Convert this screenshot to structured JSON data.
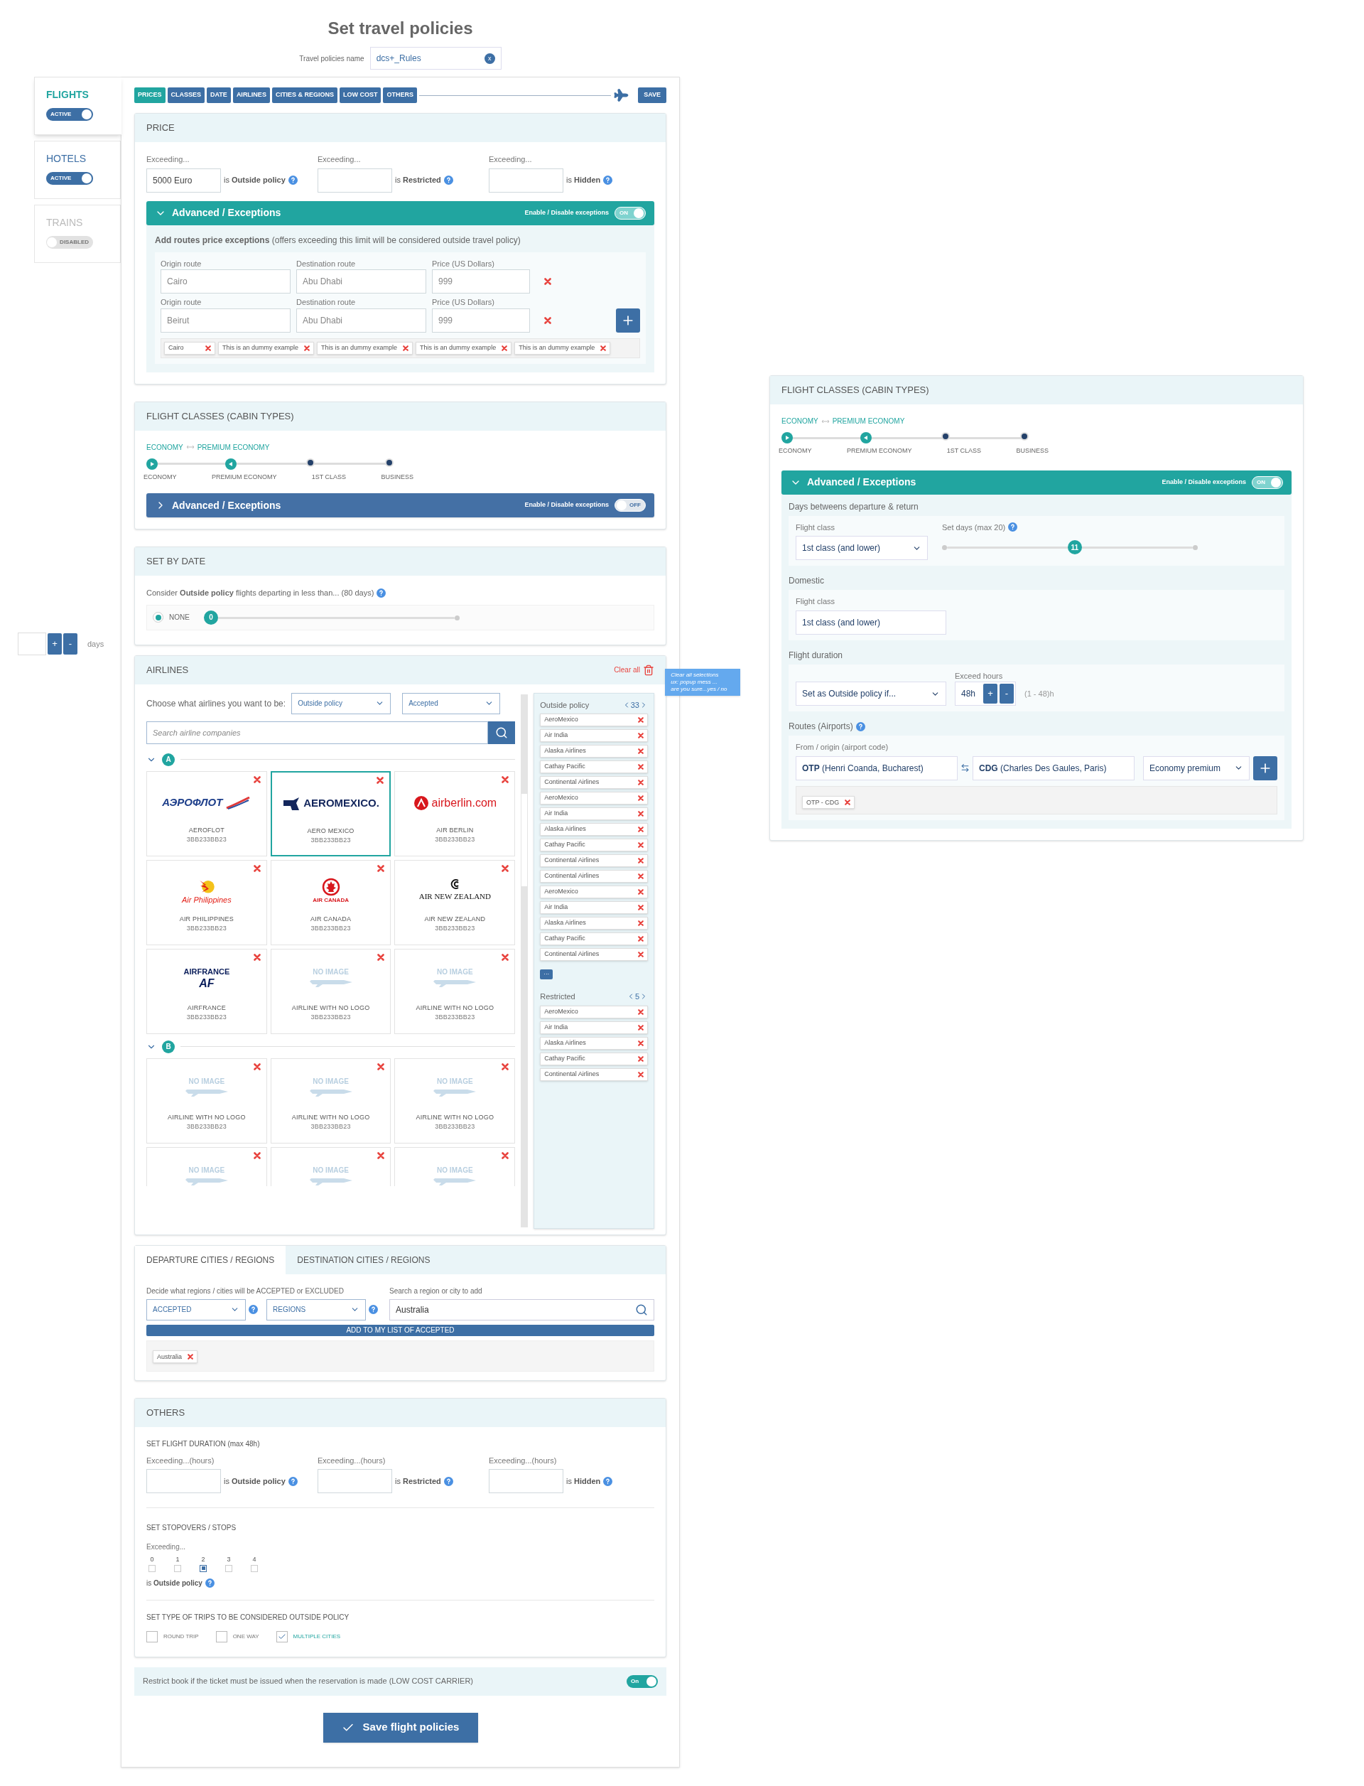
{
  "page_title": "Set travel policies",
  "policy_name": {
    "label": "Travel policies name",
    "value": "dcs+_Rules",
    "clear": "x"
  },
  "categories": [
    {
      "label": "FLIGHTS",
      "status": "ACTIVE",
      "on": true,
      "selected": true
    },
    {
      "label": "HOTELS",
      "status": "ACTIVE",
      "on": true,
      "selected": false
    },
    {
      "label": "TRAINS",
      "status": "DISABLED",
      "on": false,
      "selected": false
    }
  ],
  "days_widget": {
    "plus": "+",
    "minus": "-",
    "unit": "days"
  },
  "nav_tabs": [
    {
      "label": "PRICES",
      "selected": true
    },
    {
      "label": "CLASSES",
      "selected": false
    },
    {
      "label": "DATE",
      "selected": false
    },
    {
      "label": "AIRLINES",
      "selected": false
    },
    {
      "label": "CITIES & REGIONS",
      "selected": false
    },
    {
      "label": "LOW COST",
      "selected": false
    },
    {
      "label": "OTHERS",
      "selected": false
    }
  ],
  "save_top": "SAVE",
  "price": {
    "title": "PRICE",
    "thresholds": [
      {
        "label": "Exceeding...",
        "value": "5000 Euro",
        "suffix": "is **Outside policy**"
      },
      {
        "label": "Exceeding...",
        "suffix": "is **Restricted**"
      },
      {
        "label": "Exceeding...",
        "suffix": "is **Hidden**"
      }
    ],
    "advanced": {
      "title": "Advanced / Exceptions",
      "expanded": true,
      "toggle_label": "Enable / Disable exceptions",
      "on": true,
      "toggle_text": "ON"
    },
    "intro": "**Add routes price exceptions** (offers exceeding this limit will be considered outside travel policy)",
    "routes": [
      {
        "origin": {
          "label": "Origin route",
          "placeholder": "Cairo"
        },
        "dest": {
          "label": "Destination route",
          "placeholder": "Abu Dhabi"
        },
        "price": {
          "label": "Price (US Dollars)",
          "placeholder": "999"
        }
      },
      {
        "origin": {
          "label": "Origin route",
          "placeholder": "Beirut"
        },
        "dest": {
          "label": "Destination route",
          "placeholder": "Abu Dhabi"
        },
        "price": {
          "label": "Price (US Dollars)",
          "placeholder": "999"
        }
      }
    ],
    "tags": [
      "Cairo",
      "This is an dummy example",
      "This is an dummy example",
      "This is an dummy example",
      "This is an dummy example"
    ]
  },
  "classes": {
    "title": "FLIGHT CLASSES (CABIN TYPES)",
    "range_from": "ECONOMY",
    "range_to": "PREMIUM ECONOMY",
    "stops": [
      {
        "label": "ECONOMY",
        "kind": "start"
      },
      {
        "label": "PREMIUM ECONOMY",
        "kind": "end"
      },
      {
        "label": "1ST CLASS",
        "kind": "stop"
      },
      {
        "label": "BUSINESS",
        "kind": "stop"
      }
    ],
    "advanced": {
      "title": "Advanced / Exceptions",
      "expanded": false,
      "toggle_label": "Enable / Disable exceptions",
      "on": false,
      "toggle_text": "OFF"
    }
  },
  "by_date": {
    "title": "SET BY DATE",
    "text": "Consider **Outside policy** flights departing in less than... (80 days)",
    "radio": {
      "label": "NONE",
      "checked": true
    },
    "slider": {
      "value": "0",
      "level": 0
    }
  },
  "airlines": {
    "title": "AIRLINES",
    "clear_all": "Clear all",
    "tooltip": [
      "Clear all selections",
      "ux: popup mess ...",
      "are you sure...yes / no"
    ],
    "choose_label": "Choose what airlines you want to be:",
    "selects": [
      "Outside policy",
      "Accepted"
    ],
    "search_placeholder": "Search airline companies",
    "groups": [
      {
        "letter": "A",
        "expanded": true,
        "items": [
          {
            "name": "AEROFLOT",
            "code": "3BB233BB23",
            "kind": "aeroflot",
            "logo_lines": [
              "АЭРОФЛОТ"
            ],
            "selected": false
          },
          {
            "name": "AERO MEXICO",
            "code": "3BB233BB23",
            "kind": "aeromexico",
            "logo_lines": [
              "AEROMEXICO."
            ],
            "selected": true
          },
          {
            "name": "AIR BERLIN",
            "code": "3BB233BB23",
            "kind": "airberlin",
            "logo_lines": [
              "airberlin.com"
            ],
            "selected": false
          },
          {
            "name": "AIR PHILIPPINES",
            "code": "3BB233BB23",
            "kind": "philippines",
            "logo_lines": [
              "Air Philippines"
            ],
            "selected": false
          },
          {
            "name": "AIR CANADA",
            "code": "3BB233BB23",
            "kind": "canada",
            "logo_lines": [
              "AIR CANADA"
            ],
            "selected": false
          },
          {
            "name": "AIR NEW ZEALAND",
            "code": "3BB233BB23",
            "kind": "newzealand",
            "logo_lines": [
              "AIR NEW ZEALAND"
            ],
            "selected": false
          },
          {
            "name": "AIRFRANCE",
            "code": "3BB233BB23",
            "kind": "airfrance",
            "logo_lines": [
              "AIRFRANCE",
              "AF"
            ],
            "selected": false
          },
          {
            "name": "AIRLINE WITH NO LOGO",
            "code": "3BB233BB23",
            "kind": "none",
            "logo_lines": [
              "NO IMAGE"
            ],
            "selected": false
          },
          {
            "name": "AIRLINE WITH NO LOGO",
            "code": "3BB233BB23",
            "kind": "none",
            "logo_lines": [
              "NO IMAGE"
            ],
            "selected": false
          }
        ]
      },
      {
        "letter": "B",
        "expanded": true,
        "items": [
          {
            "name": "AIRLINE WITH NO LOGO",
            "code": "3BB233BB23",
            "kind": "none",
            "logo_lines": [
              "NO IMAGE"
            ],
            "selected": false
          },
          {
            "name": "AIRLINE WITH NO LOGO",
            "code": "3BB233BB23",
            "kind": "none",
            "logo_lines": [
              "NO IMAGE"
            ],
            "selected": false
          },
          {
            "name": "AIRLINE WITH NO LOGO",
            "code": "3BB233BB23",
            "kind": "none",
            "logo_lines": [
              "NO IMAGE"
            ],
            "selected": false
          },
          {
            "kind": "none",
            "logo_lines": [
              "NO IMAGE"
            ],
            "selected": false
          },
          {
            "kind": "none",
            "logo_lines": [
              "NO IMAGE"
            ],
            "selected": false
          },
          {
            "kind": "none",
            "logo_lines": [
              "NO IMAGE"
            ],
            "selected": false
          }
        ]
      }
    ],
    "lists": [
      {
        "title": "Outside policy",
        "count": "33",
        "items": [
          "AeroMexico",
          "Air India",
          "Alaska Airlines",
          "Cathay Pacific",
          "Continental Airlines",
          "AeroMexico",
          "Air India",
          "Alaska Airlines",
          "Cathay Pacific",
          "Continental Airlines",
          "Continental Airlines",
          "AeroMexico",
          "Air India",
          "Alaska Airlines",
          "Cathay Pacific",
          "Continental Airlines"
        ],
        "more": "···"
      },
      {
        "title": "Restricted",
        "count": "5",
        "items": [
          "AeroMexico",
          "Air India",
          "Alaska Airlines",
          "Cathay Pacific",
          "Continental Airlines"
        ]
      }
    ]
  },
  "cities": {
    "tabs": [
      {
        "label": "DEPARTURE CITIES / REGIONS",
        "selected": true
      },
      {
        "label": "DESTINATION CITIES / REGIONS",
        "selected": false
      }
    ],
    "decide_label": "Decide what regions / cities will be ACCEPTED or EXCLUDED",
    "selects": [
      "ACCEPTED",
      "REGIONS"
    ],
    "search_label": "Search a region or city to add",
    "search_value": "Australia",
    "add_button": "ADD TO MY LIST OF ACCEPTED",
    "tags": [
      "Australia"
    ]
  },
  "others": {
    "title": "OTHERS",
    "duration_heading": "SET FLIGHT DURATION (max 48h)",
    "thresholds": [
      {
        "label": "Exceeding...(hours)",
        "suffix": "is **Outside policy**"
      },
      {
        "label": "Exceeding...(hours)",
        "suffix": "is **Restricted**"
      },
      {
        "label": "Exceeding...(hours)",
        "suffix": "is **Hidden**"
      }
    ],
    "stops_heading": "SET STOPOVERS / STOPS",
    "stops_label": "Exceeding...",
    "stops": [
      {
        "label": "0",
        "selected": false
      },
      {
        "label": "1",
        "selected": false
      },
      {
        "label": "2",
        "selected": true
      },
      {
        "label": "3",
        "selected": false
      },
      {
        "label": "4",
        "selected": false
      }
    ],
    "stops_suffix": "is **Outside policy**",
    "trips_heading": "SET TYPE OF TRIPS TO BE CONSIDERED OUTSIDE POLICY",
    "trips": [
      {
        "label": "ROUND TRIP",
        "checked": false
      },
      {
        "label": "ONE WAY",
        "checked": false
      },
      {
        "label": "MULTIPLE CITIES",
        "checked": true
      }
    ]
  },
  "low_cost": {
    "text": "Restrict book if the ticket must be issued when the reservation is made (LOW COST CARRIER)",
    "on": true,
    "toggle_text": "On"
  },
  "save_button": "Save flight policies",
  "side_panel": {
    "title": "FLIGHT CLASSES (CABIN TYPES)",
    "range_from": "ECONOMY",
    "range_to": "PREMIUM ECONOMY",
    "stops": [
      {
        "label": "ECONOMY",
        "kind": "start"
      },
      {
        "label": "PREMIUM ECONOMY",
        "kind": "end"
      },
      {
        "label": "1ST CLASS",
        "kind": "stop"
      },
      {
        "label": "BUSINESS",
        "kind": "stop"
      }
    ],
    "advanced": {
      "title": "Advanced / Exceptions",
      "expanded": true,
      "toggle_label": "Enable / Disable exceptions",
      "on": true,
      "toggle_text": "ON"
    },
    "days": {
      "heading": "Days betweens departure & return",
      "class_label": "Flight class",
      "class_value": "1st class (and lower)",
      "set_label": "Set days (max 20)",
      "slider": {
        "value": "11",
        "level": 0.52
      }
    },
    "domestic": {
      "heading": "Domestic",
      "class_label": "Flight class",
      "class_value": "1st class (and lower)"
    },
    "duration": {
      "heading": "Flight duration",
      "select": "Set as Outside policy if...",
      "hours_label": "Exceed hours",
      "hours": "48h",
      "plus": "+",
      "minus": "-",
      "range": "(1 - 48)h"
    },
    "routes": {
      "heading": "Routes (Airports)",
      "from_label": "From / origin (airport code)",
      "from": "**OTP** (Henri Coanda, Bucharest)",
      "to": "**CDG** (Charles Des Gaules, Paris)",
      "class_select": "Economy premium",
      "tags": [
        "OTP - CDG"
      ]
    }
  }
}
